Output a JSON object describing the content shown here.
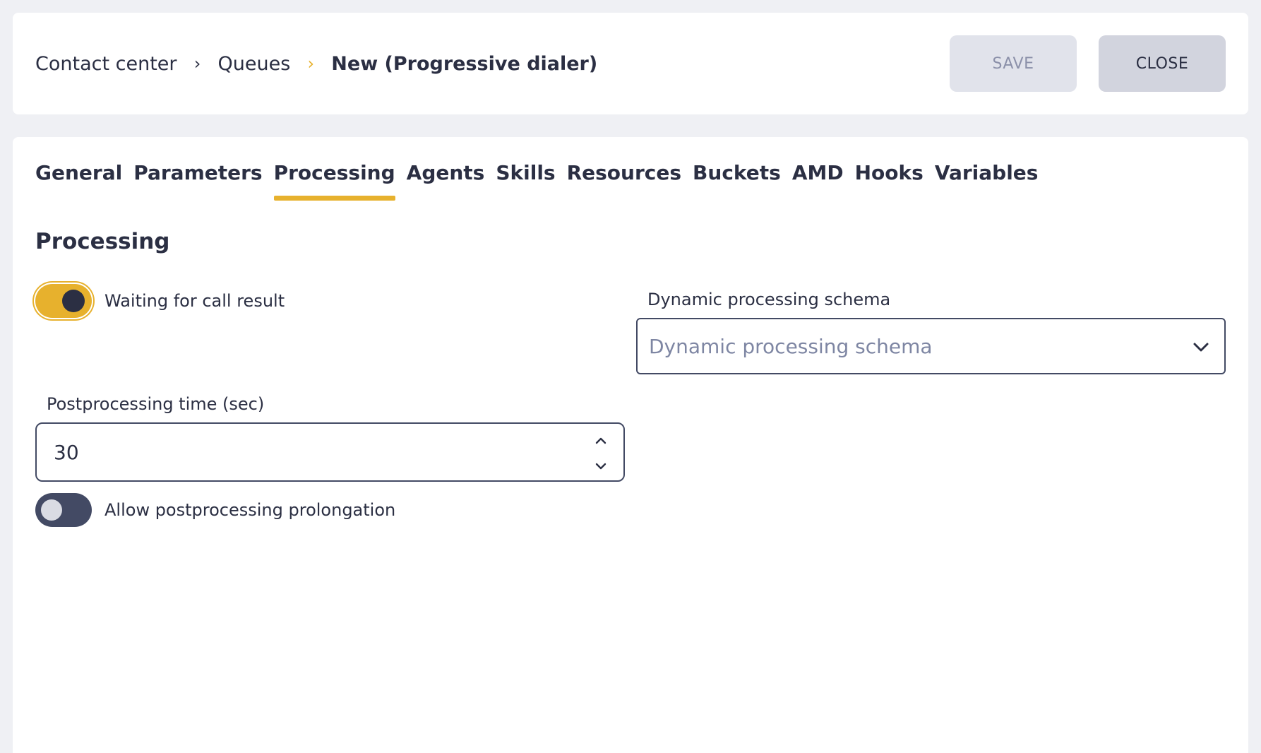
{
  "breadcrumb": {
    "items": [
      "Contact center",
      "Queues",
      "New (Progressive dialer)"
    ],
    "separator": "›"
  },
  "header": {
    "save_label": "SAVE",
    "close_label": "CLOSE"
  },
  "tabs": [
    {
      "label": "General",
      "active": false
    },
    {
      "label": "Parameters",
      "active": false
    },
    {
      "label": "Processing",
      "active": true
    },
    {
      "label": "Agents",
      "active": false
    },
    {
      "label": "Skills",
      "active": false
    },
    {
      "label": "Resources",
      "active": false
    },
    {
      "label": "Buckets",
      "active": false
    },
    {
      "label": "AMD",
      "active": false
    },
    {
      "label": "Hooks",
      "active": false
    },
    {
      "label": "Variables",
      "active": false
    }
  ],
  "section": {
    "title": "Processing"
  },
  "form": {
    "waiting_toggle": {
      "label": "Waiting for call result",
      "on": true
    },
    "schema": {
      "label": "Dynamic processing schema",
      "placeholder": "Dynamic processing schema",
      "value": ""
    },
    "postprocessing_time": {
      "label": "Postprocessing time (sec)",
      "value": "30"
    },
    "prolongation_toggle": {
      "label": "Allow postprocessing prolongation",
      "on": false
    }
  },
  "colors": {
    "accent": "#e7b12d",
    "text": "#2b2f43",
    "background": "#eff0f4",
    "border": "#434a64"
  }
}
